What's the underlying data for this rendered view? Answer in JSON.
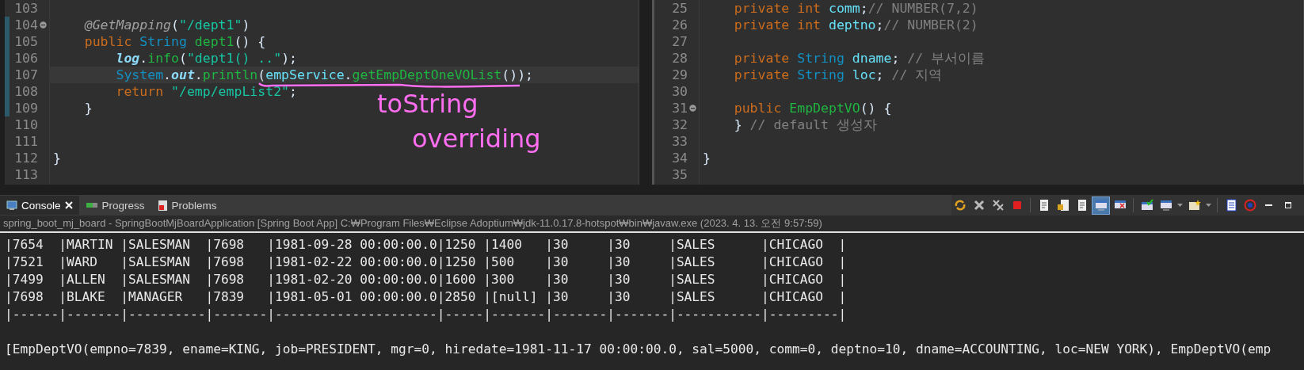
{
  "editors": [
    {
      "lines": [
        {
          "number": "103"
        },
        {
          "number": "104",
          "changed": true,
          "fold": true,
          "tokens": [
            {
              "kind": "annotation",
              "text": "    @GetMapping"
            },
            {
              "kind": "plain",
              "text": "("
            },
            {
              "kind": "string",
              "text": "\"/dept1\""
            },
            {
              "kind": "plain",
              "text": ")"
            }
          ]
        },
        {
          "number": "105",
          "changed": true,
          "tokens": [
            {
              "kind": "keyword",
              "text": "    public "
            },
            {
              "kind": "type",
              "text": "String "
            },
            {
              "kind": "method",
              "text": "dept1"
            },
            {
              "kind": "plain",
              "text": "() {"
            }
          ]
        },
        {
          "number": "106",
          "changed": true,
          "tokens": [
            {
              "kind": "static",
              "text": "        log"
            },
            {
              "kind": "plain",
              "text": "."
            },
            {
              "kind": "method",
              "text": "info"
            },
            {
              "kind": "plain",
              "text": "("
            },
            {
              "kind": "string",
              "text": "\"dept1() ..\""
            },
            {
              "kind": "plain",
              "text": ");"
            }
          ]
        },
        {
          "number": "107",
          "changed": true,
          "current": true,
          "tokens": [
            {
              "kind": "type",
              "text": "        System"
            },
            {
              "kind": "plain",
              "text": "."
            },
            {
              "kind": "static",
              "text": "out"
            },
            {
              "kind": "plain",
              "text": "."
            },
            {
              "kind": "method",
              "text": "println"
            },
            {
              "kind": "plain",
              "text": "("
            },
            {
              "kind": "field",
              "text": "empService"
            },
            {
              "kind": "plain",
              "text": "."
            },
            {
              "kind": "method",
              "text": "getEmpDeptOneVOList"
            },
            {
              "kind": "plain",
              "text": "());"
            }
          ]
        },
        {
          "number": "108",
          "changed": true,
          "tokens": [
            {
              "kind": "keyword",
              "text": "        return "
            },
            {
              "kind": "string",
              "text": "\"/emp/empList2\""
            },
            {
              "kind": "plain",
              "text": ";"
            }
          ]
        },
        {
          "number": "109",
          "changed": true,
          "tokens": [
            {
              "kind": "plain",
              "text": "    }"
            }
          ]
        },
        {
          "number": "110"
        },
        {
          "number": "111"
        },
        {
          "number": "112",
          "tokens": [
            {
              "kind": "plain",
              "text": "}"
            }
          ]
        },
        {
          "number": "113"
        }
      ],
      "note": {
        "lines": [
          "toString",
          "overriding"
        ]
      }
    },
    {
      "lines": [
        {
          "number": "25",
          "tokens": [
            {
              "kind": "keyword",
              "text": "    private int "
            },
            {
              "kind": "field",
              "text": "comm"
            },
            {
              "kind": "plain",
              "text": ";"
            },
            {
              "kind": "comment",
              "text": "// NUMBER(7,2)"
            }
          ]
        },
        {
          "number": "26",
          "tokens": [
            {
              "kind": "keyword",
              "text": "    private int "
            },
            {
              "kind": "field",
              "text": "deptno"
            },
            {
              "kind": "plain",
              "text": ";"
            },
            {
              "kind": "comment",
              "text": "// NUMBER(2)"
            }
          ]
        },
        {
          "number": "27"
        },
        {
          "number": "28",
          "tokens": [
            {
              "kind": "keyword",
              "text": "    private "
            },
            {
              "kind": "type",
              "text": "String "
            },
            {
              "kind": "field",
              "text": "dname"
            },
            {
              "kind": "plain",
              "text": "; "
            },
            {
              "kind": "comment",
              "text": "// 부서이름"
            }
          ]
        },
        {
          "number": "29",
          "tokens": [
            {
              "kind": "keyword",
              "text": "    private "
            },
            {
              "kind": "type",
              "text": "String "
            },
            {
              "kind": "field",
              "text": "loc"
            },
            {
              "kind": "plain",
              "text": "; "
            },
            {
              "kind": "comment",
              "text": "// 지역"
            }
          ]
        },
        {
          "number": "30"
        },
        {
          "number": "31",
          "fold": true,
          "tokens": [
            {
              "kind": "keyword",
              "text": "    public "
            },
            {
              "kind": "method",
              "text": "EmpDeptVO"
            },
            {
              "kind": "plain",
              "text": "() {"
            }
          ]
        },
        {
          "number": "32",
          "tokens": [
            {
              "kind": "plain",
              "text": "    } "
            },
            {
              "kind": "comment",
              "text": "// default 생성자"
            }
          ]
        },
        {
          "number": "33"
        },
        {
          "number": "34",
          "tokens": [
            {
              "kind": "plain",
              "text": "}"
            }
          ]
        },
        {
          "number": "35"
        }
      ]
    }
  ],
  "console": {
    "tabs": [
      {
        "label": "Console",
        "selected": true,
        "closable": true,
        "kind": "console"
      },
      {
        "label": "Progress",
        "selected": false,
        "kind": "progress"
      },
      {
        "label": "Problems",
        "selected": false,
        "kind": "problems"
      }
    ],
    "toolbar": [
      {
        "kind": "sync",
        "pressed": false
      },
      {
        "kind": "cross",
        "pressed": false
      },
      {
        "kind": "crosses",
        "pressed": false
      },
      {
        "kind": "stop",
        "pressed": false
      },
      {
        "kind": "sep"
      },
      {
        "kind": "doc",
        "pressed": false
      },
      {
        "kind": "lockdoc",
        "pressed": false
      },
      {
        "kind": "doc",
        "pressed": false
      },
      {
        "kind": "screen",
        "pressed": true
      },
      {
        "kind": "screenx",
        "pressed": false
      },
      {
        "kind": "sep"
      },
      {
        "kind": "monitor",
        "pressed": false
      },
      {
        "kind": "screen",
        "pressed": false
      },
      {
        "kind": "caret",
        "pressed": false
      },
      {
        "kind": "folder",
        "pressed": false
      },
      {
        "kind": "caret",
        "pressed": false
      },
      {
        "kind": "sep"
      },
      {
        "kind": "list",
        "pressed": false
      },
      {
        "kind": "circle",
        "pressed": false
      },
      {
        "kind": "min",
        "pressed": false
      },
      {
        "kind": "max",
        "pressed": false
      }
    ],
    "status": "spring_boot_mj_board - SpringBootMjBoardApplication [Spring Boot App] C:₩Program Files₩Eclipse Adoptium₩jdk-11.0.17.8-hotspot₩bin₩javaw.exe (2023. 4. 13. 오전 9:57:59)",
    "table_lines": [
      "|7654  |MARTIN |SALESMAN  |7698   |1981-09-28 00:00:00.0|1250 |1400   |30     |30     |SALES      |CHICAGO  |",
      "|7521  |WARD   |SALESMAN  |7698   |1981-02-22 00:00:00.0|1250 |500    |30     |30     |SALES      |CHICAGO  |",
      "|7499  |ALLEN  |SALESMAN  |7698   |1981-02-20 00:00:00.0|1600 |300    |30     |30     |SALES      |CHICAGO  |",
      "|7698  |BLAKE  |MANAGER   |7839   |1981-05-01 00:00:00.0|2850 |[null] |30     |30     |SALES      |CHICAGO  |",
      "|------|-------|----------|-------|---------------------|-----|-------|-------|-------|-----------|---------|"
    ],
    "output_lines": [
      "[EmpDeptVO(empno=7839, ename=KING, job=PRESIDENT, mgr=0, hiredate=1981-11-17 00:00:00.0, sal=5000, comm=0, deptno=10, dname=ACCOUNTING, loc=NEW YORK), EmpDeptVO(emp"
    ]
  }
}
